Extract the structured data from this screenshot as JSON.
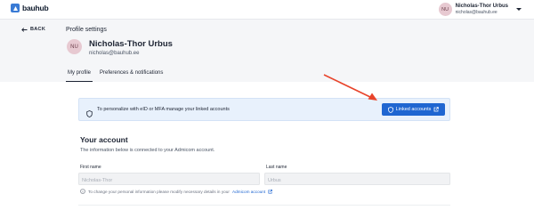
{
  "topbar": {
    "logo_text": "bauhub",
    "user_initials": "NU",
    "user_name": "Nicholas-Thor Urbus",
    "user_email": "nicholas@bauhub.ee"
  },
  "header": {
    "back_label": "BACK",
    "page_title": "Profile settings",
    "avatar_initials": "NU",
    "profile_name": "Nicholas-Thor Urbus",
    "profile_email": "nicholas@bauhub.ee",
    "tabs": [
      {
        "label": "My profile",
        "active": true
      },
      {
        "label": "Preferences & notifications",
        "active": false
      }
    ]
  },
  "banner": {
    "text": "To personalize with eID or MFA manage your linked accounts",
    "button_label": "Linked accounts"
  },
  "account": {
    "title": "Your account",
    "subtitle": "The information below is connected to your Admicom account.",
    "first_name_label": "First name",
    "first_name_value": "Nicholas-Thor",
    "last_name_label": "Last name",
    "last_name_value": "Urbus",
    "note_text": "To change your personal information please modify necessary details in your",
    "note_link": "Admicom account"
  },
  "colors": {
    "accent": "#1f66d1",
    "banner_bg": "#e8f1fc",
    "annotation_arrow": "#e8442b",
    "avatar_bg": "#e7c9d1"
  },
  "icons": [
    "bauhub-logo-icon",
    "chevron-down-icon",
    "arrow-left-icon",
    "shield-icon",
    "external-link-icon",
    "info-icon"
  ]
}
